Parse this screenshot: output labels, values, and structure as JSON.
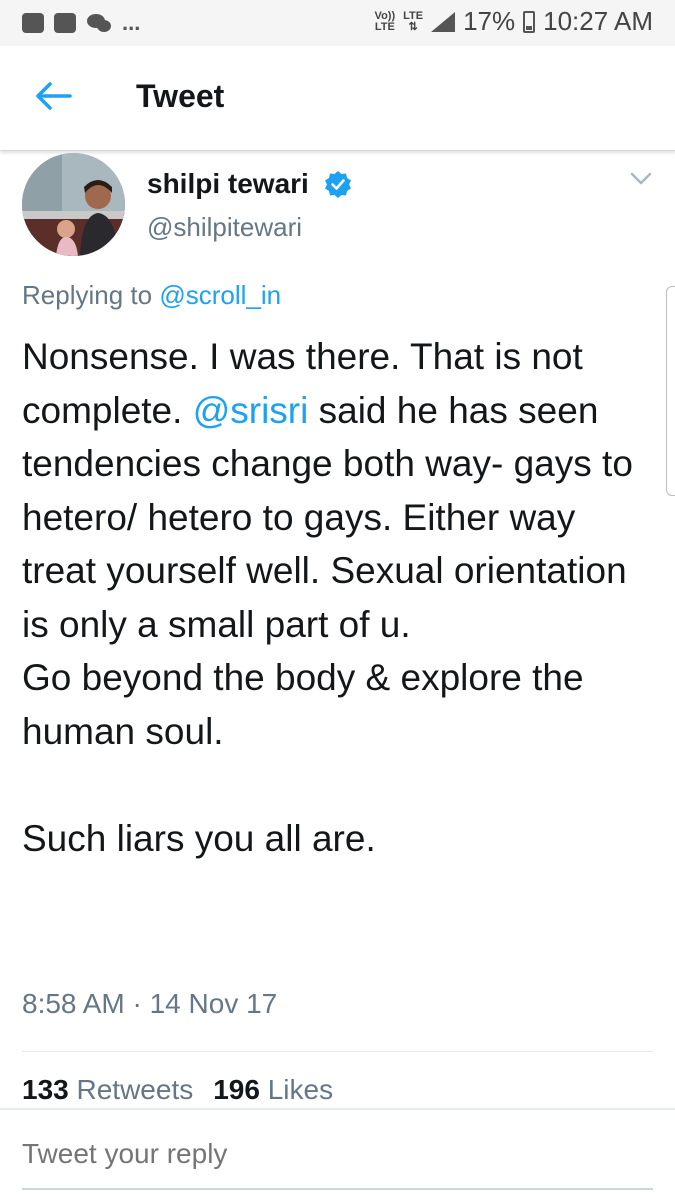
{
  "status_bar": {
    "dots": "...",
    "network": "Vo)) LTE",
    "network_lte": "LTE",
    "battery": "17%",
    "time": "10:27 AM"
  },
  "header": {
    "back_icon": "arrow-left-icon",
    "title": "Tweet"
  },
  "tweet": {
    "author_name": "shilpi tewari",
    "handle": "@shilpitewari",
    "replying_prefix": "Replying to",
    "replying_to": "@scroll_in",
    "text_before_mention": "Nonsense. I was there. That is not complete. ",
    "mention": "@srisri",
    "text_after_mention": " said he has seen tendencies change both way- gays to hetero/ hetero to gays. Either way treat yourself well. Sexual orientation is only a small part of u.\nGo beyond the body & explore the human soul.\n\nSuch liars you all are.",
    "timestamp": "8:58 AM · 14 Nov 17",
    "retweets_count": "133",
    "retweets_label": "Retweets",
    "likes_count": "196",
    "likes_label": "Likes"
  },
  "reply": {
    "placeholder": "Tweet your reply"
  },
  "colors": {
    "accent": "#1da1f2",
    "secondary_text": "#657786",
    "primary_text": "#14171a"
  }
}
